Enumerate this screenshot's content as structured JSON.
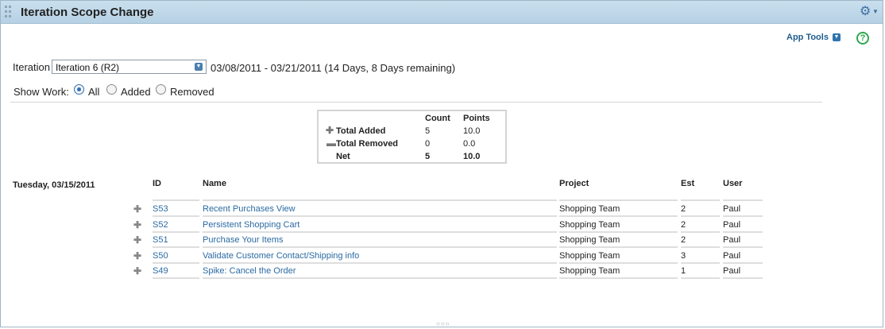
{
  "app": {
    "title": "Iteration Scope Change"
  },
  "icons": {
    "settings": "gear-icon",
    "help": "help-icon"
  },
  "toolbar": {
    "app_tools_label": "App Tools",
    "help_glyph": "?"
  },
  "iteration": {
    "label": "Iteration",
    "selected": "Iteration 6 (R2)",
    "dates": "03/08/2011 - 03/21/2011 (14 Days, 8 Days remaining)"
  },
  "show_work": {
    "label": "Show Work:",
    "options": [
      {
        "label": "All",
        "selected": true
      },
      {
        "label": "Added",
        "selected": false
      },
      {
        "label": "Removed",
        "selected": false
      }
    ]
  },
  "summary": {
    "headers": {
      "count": "Count",
      "points": "Points"
    },
    "rows": [
      {
        "label": "Total Added",
        "count": "5",
        "points": "10.0"
      },
      {
        "label": "Total Removed",
        "count": "0",
        "points": "0.0"
      },
      {
        "label": "Net",
        "count": "5",
        "points": "10.0"
      }
    ]
  },
  "day": {
    "date": "Tuesday, 03/15/2011",
    "columns": {
      "id": "ID",
      "name": "Name",
      "project": "Project",
      "est": "Est",
      "user": "User"
    },
    "rows": [
      {
        "id": "S53",
        "name": "Recent Purchases View",
        "project": "Shopping Team",
        "est": "2",
        "user": "Paul"
      },
      {
        "id": "S52",
        "name": "Persistent Shopping Cart",
        "project": "Shopping Team",
        "est": "2",
        "user": "Paul"
      },
      {
        "id": "S51",
        "name": "Purchase Your Items",
        "project": "Shopping Team",
        "est": "2",
        "user": "Paul"
      },
      {
        "id": "S50",
        "name": "Validate Customer Contact/Shipping info",
        "project": "Shopping Team",
        "est": "3",
        "user": "Paul"
      },
      {
        "id": "S49",
        "name": "Spike: Cancel the Order",
        "project": "Shopping Team",
        "est": "1",
        "user": "Paul"
      }
    ]
  }
}
